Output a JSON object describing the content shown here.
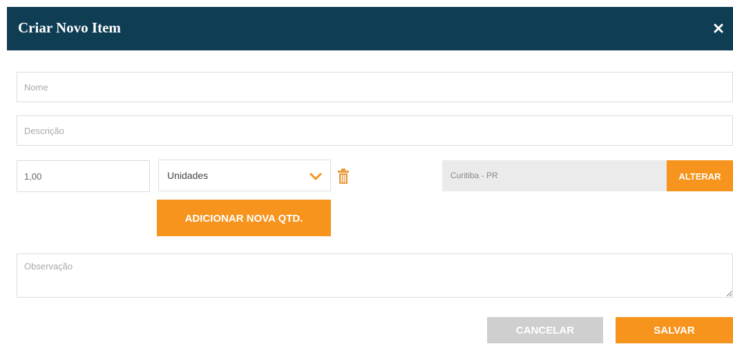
{
  "modal": {
    "title": "Criar Novo Item",
    "close_label": "×"
  },
  "form": {
    "nome_placeholder": "Nome",
    "descricao_placeholder": "Descrição",
    "quantity_value": "1,00",
    "unit_selected": "Unidades",
    "location_value": "Curitiba - PR",
    "alterar_label": "ALTERAR",
    "add_qty_label": "ADICIONAR NOVA QTD.",
    "observacao_placeholder": "Observação"
  },
  "footer": {
    "cancel_label": "CANCELAR",
    "save_label": "SALVAR"
  },
  "colors": {
    "header_bg": "#0f3d53",
    "accent_orange": "#f7941d",
    "cancel_gray": "#cfcfcf",
    "location_bg": "#ebebeb"
  },
  "icons": {
    "close": "close-icon",
    "chevron": "chevron-down-icon",
    "trash": "trash-icon"
  }
}
